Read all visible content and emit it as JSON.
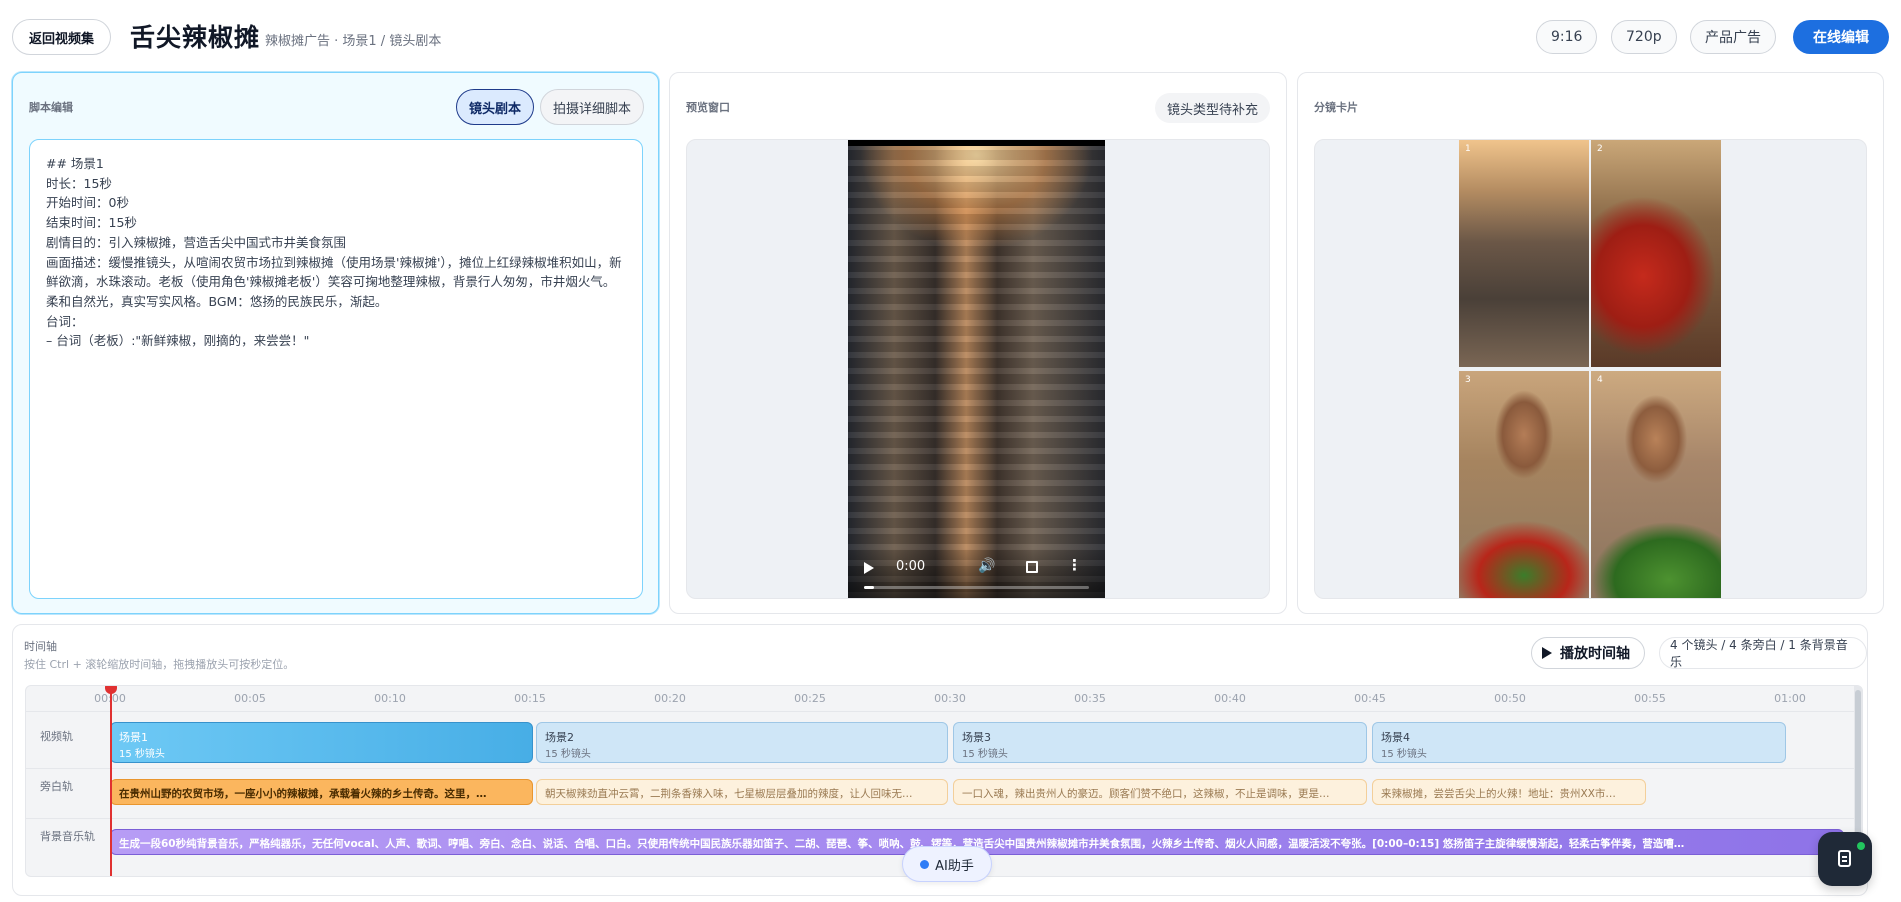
{
  "header": {
    "back_label": "返回视频集",
    "title": "舌尖辣椒摊",
    "breadcrumb": "辣椒摊广告 · 场景1 / 镜头剧本",
    "ratio": "9:16",
    "resolution": "720p",
    "category": "产品广告",
    "edit_label": "在线编辑"
  },
  "script_panel": {
    "label": "脚本编辑",
    "tab_shot": "镜头剧本",
    "tab_detail": "拍摄详细脚本",
    "content": "## 场景1\n时长：15秒\n开始时间：0秒\n结束时间：15秒\n剧情目的：引入辣椒摊，营造舌尖中国式市井美食氛围\n画面描述：缓慢推镜头，从喧闹农贸市场拉到辣椒摊（使用场景'辣椒摊'），摊位上红绿辣椒堆积如山，新鲜欲滴，水珠滚动。老板（使用角色'辣椒摊老板'）笑容可掬地整理辣椒，背景行人匆匆，市井烟火气。柔和自然光，真实写实风格。BGM：悠扬的民族民乐，渐起。\n台词：\n– 台词（老板）:\"新鲜辣椒，刚摘的，来尝尝！\""
  },
  "preview_panel": {
    "label": "预览窗口",
    "badge": "镜头类型待补充",
    "video_time": "0:00"
  },
  "storyboard_panel": {
    "label": "分镜卡片",
    "frames": [
      "1",
      "2",
      "3",
      "4"
    ]
  },
  "timeline": {
    "title": "时间轴",
    "hint": "按住 Ctrl + 滚轮缩放时间轴，拖拽播放头可按秒定位。",
    "play_label": "播放时间轴",
    "stats": "4 个镜头 / 4 条旁白 / 1 条背景音乐",
    "ticks": [
      "00:00",
      "00:05",
      "00:10",
      "00:15",
      "00:20",
      "00:25",
      "00:30",
      "00:35",
      "00:40",
      "00:45",
      "00:50",
      "00:55",
      "01:00"
    ],
    "tracks": {
      "video_label": "视频轨",
      "voice_label": "旁白轨",
      "music_label": "背景音乐轨"
    },
    "video_clips": [
      {
        "title": "场景1",
        "sub": "15 秒镜头"
      },
      {
        "title": "场景2",
        "sub": "15 秒镜头"
      },
      {
        "title": "场景3",
        "sub": "15 秒镜头"
      },
      {
        "title": "场景4",
        "sub": "15 秒镜头"
      }
    ],
    "voice_clips": [
      "在贵州山野的农贸市场，一座小小的辣椒摊，承载着火辣的乡土传奇。这里，…",
      "朝天椒辣劲直冲云霄，二荆条香辣入味，七星椒层层叠加的辣度，让人回味无…",
      "一口入魂，辣出贵州人的豪迈。顾客们赞不绝口，这辣椒，不止是调味，更是…",
      "来辣椒摊，尝尝舌尖上的火辣！地址：贵州XX市…"
    ],
    "music_clip": "生成一段60秒纯背景音乐，严格纯器乐，无任何vocal、人声、歌词、哼唱、旁白、念白、说话、合唱、口白。只使用传统中国民族乐器如笛子、二胡、琵琶、筝、唢呐、鼓、锣等，营造舌尖中国贵州辣椒摊市井美食氛围，火辣乡土传奇、烟火人间感，温暖活泼不夸张。[0:00–0:15] 悠扬笛子主旋律缓慢渐起，轻柔古筝伴奏，营造嘈…"
  },
  "ai_assistant_label": "AI助手"
}
